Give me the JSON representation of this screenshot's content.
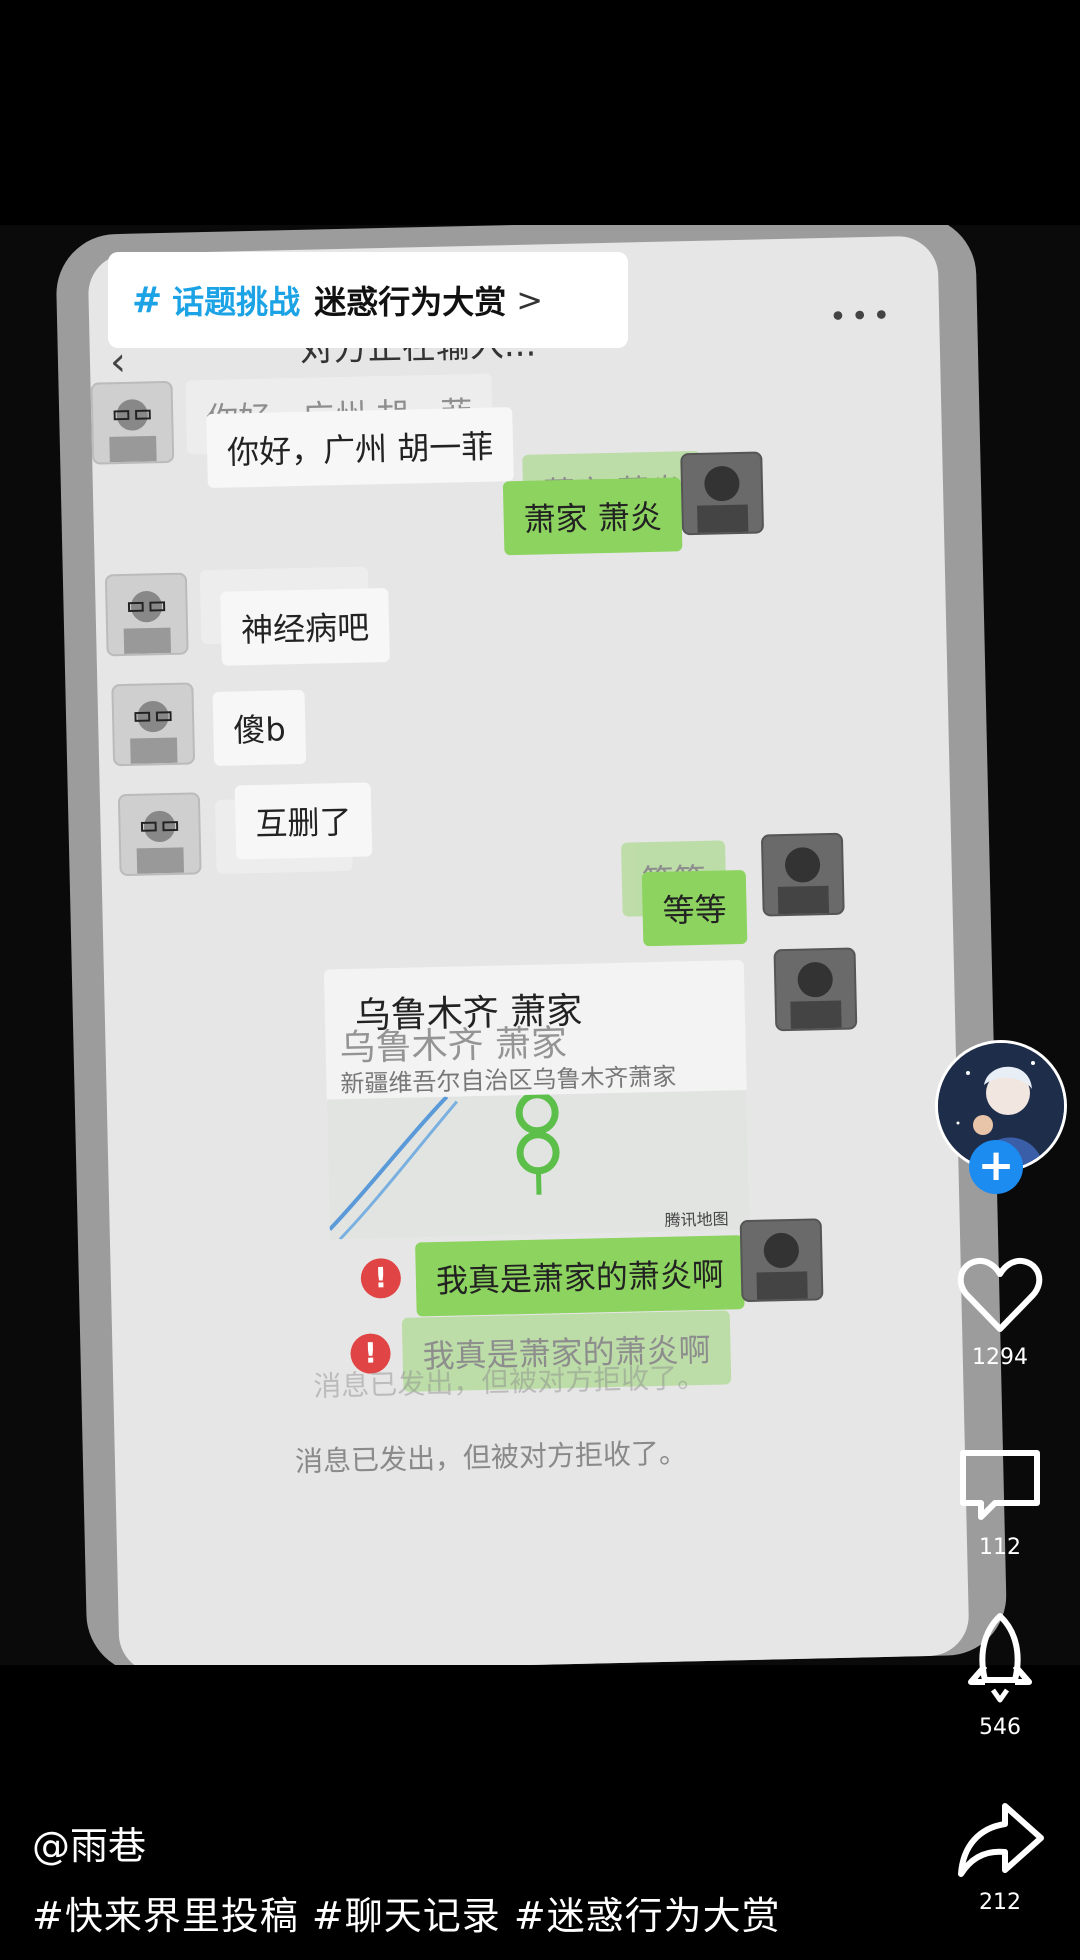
{
  "topic_banner": {
    "hash": "#",
    "tag": "话题挑战",
    "name": "迷惑行为大赏",
    "chevron": "chevron-right-icon"
  },
  "chat": {
    "title": "对方正在输入...",
    "more_icon": "more-dots-icon",
    "back_icon": "back-arrow-icon",
    "messages": [
      {
        "side": "left",
        "text": "你好，广州 胡一菲"
      },
      {
        "side": "right",
        "text": "萧家 萧炎"
      },
      {
        "side": "left",
        "text": "神经病吧"
      },
      {
        "side": "left",
        "text": "傻b"
      },
      {
        "side": "left",
        "text": "互删了"
      },
      {
        "side": "right",
        "text": "等等"
      },
      {
        "side": "right",
        "type": "location",
        "title": "乌鲁木齐 萧家",
        "address": "新疆维吾尔自治区乌鲁木齐萧家",
        "map_brand": "腾讯地图"
      },
      {
        "side": "right",
        "text": "我真是萧家的萧炎啊",
        "status": "failed"
      }
    ],
    "system_message": "消息已发出，但被对方拒收了。"
  },
  "actions": {
    "likes": "1294",
    "comments": "112",
    "shares_boost": "546",
    "forwards": "212"
  },
  "caption": {
    "author": "@雨巷",
    "hashtags": "#快来界里投稿 #聊天记录 #迷惑行为大赏"
  },
  "colors": {
    "accent_blue": "#1ba3e6",
    "bubble_green": "#8dd35f",
    "follow_blue": "#1d8cf0",
    "error_red": "#e14444"
  }
}
